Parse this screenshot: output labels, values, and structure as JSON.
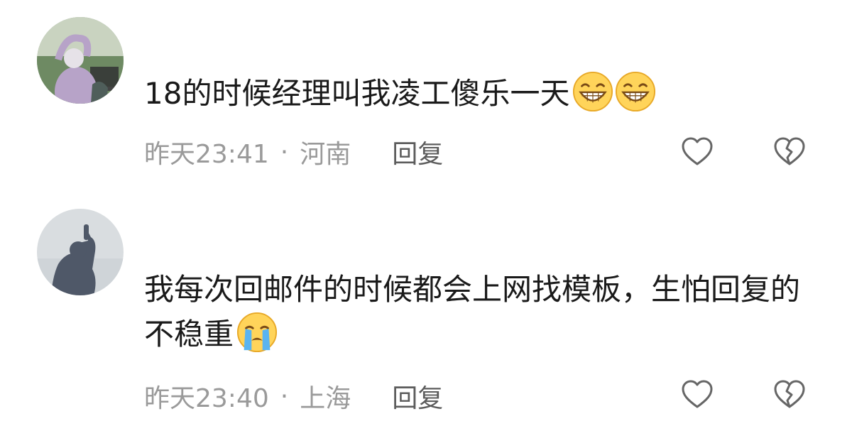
{
  "comments": [
    {
      "text": "18的时候经理叫我凌工傻乐一天",
      "emojis": [
        "grinning-face-icon",
        "grinning-face-icon"
      ],
      "time": "昨天23:41",
      "separator": "·",
      "location": "河南",
      "reply_label": "回复"
    },
    {
      "text": "我每次回邮件的时候都会上网找模板，生怕回复的不稳重",
      "emojis": [
        "loudly-crying-face-icon"
      ],
      "time": "昨天23:40",
      "separator": "·",
      "location": "上海",
      "reply_label": "回复"
    }
  ],
  "colors": {
    "text": "#1a1a1a",
    "meta": "#9a9a9a",
    "reply": "#5c5c5c",
    "icon_stroke": "#666666"
  }
}
